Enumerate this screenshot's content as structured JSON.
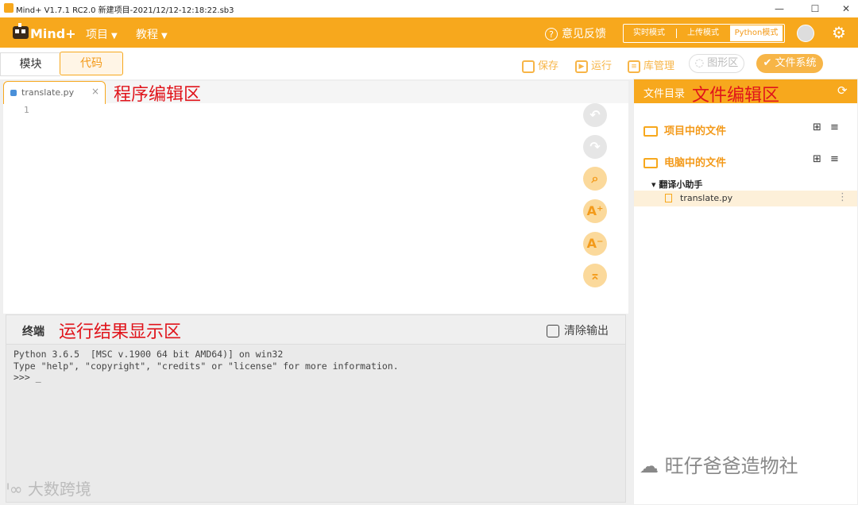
{
  "window": {
    "title": "Mind+ V1.7.1 RC2.0   新建项目-2021/12/12-12:18:22.sb3",
    "minimize": "—",
    "maximize": "☐",
    "close": "✕"
  },
  "menubar": {
    "menu_project": "项目",
    "menu_tutorial": "教程",
    "feedback": "意见反馈",
    "modes": [
      "实时模式",
      "上传模式",
      "Python模式"
    ]
  },
  "tabs": {
    "blocks": "模块",
    "code": "代码"
  },
  "toolbar": {
    "save": "保存",
    "run": "运行",
    "library": "库管理",
    "graphics": "图形区",
    "filesystem": "文件系统"
  },
  "editor": {
    "file_tab": "translate.py",
    "close": "×",
    "annotation": "程序编辑区",
    "line_number": "1"
  },
  "terminal": {
    "title": "终端",
    "annotation": "运行结果显示区",
    "clear_output": "清除输出",
    "output": "Python 3.6.5  [MSC v.1900 64 bit AMD64)] on win32\nType \"help\", \"copyright\", \"credits\" or \"license\" for more information.\n>>> _"
  },
  "filepanel": {
    "title": "文件目录",
    "annotation": "文件编辑区",
    "project_files": "项目中的文件",
    "computer_files": "电脑中的文件",
    "folder": "▾ 翻译小助手",
    "file": "translate.py"
  },
  "watermarks": {
    "left": "大数跨境",
    "right": "旺仔爸爸造物社"
  },
  "colors": {
    "accent": "#f7a81d",
    "annotation_red": "#e0141b"
  }
}
